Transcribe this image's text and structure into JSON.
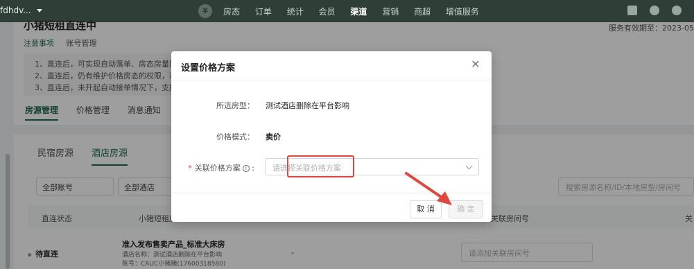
{
  "topbar": {
    "account": "fdhdv...",
    "logo": "¥",
    "nav": [
      "房态",
      "订单",
      "统计",
      "会员",
      "渠道",
      "营销",
      "商超",
      "增值服务"
    ],
    "nav_active_index": 4
  },
  "page": {
    "title": "小猪短租直连中",
    "expiry": "服务有效期至：2023-05",
    "notice_tab": "注意事项",
    "account_tab": "账号管理",
    "notices": [
      "1、直连后，可实现自动落单、房态房量同",
      "2、直连后，仍有维护价格房态的权限，若",
      "3、直连后，未开起自动接单情况下，支持"
    ],
    "main_tabs": [
      "房源管理",
      "价格管理",
      "消息通知"
    ],
    "sub_tabs": [
      "民宿房源",
      "酒店房源"
    ],
    "filters": [
      "全部账号",
      "全部酒店"
    ],
    "search_placeholder": "搜索房源名称/ID/本地房型/房间号",
    "table_headers": [
      "直连状态",
      "小猪短租房",
      "关联房间号",
      "关"
    ],
    "row": {
      "status": "待直连",
      "title": "准入发布售卖产品_标准大床房",
      "hotel": "酒店名称：测试酒店删除在平台影响",
      "account": "账号：CAUC小猪猪(17600318580)",
      "dash": "-",
      "room_placeholder": "请添加关联房间号"
    }
  },
  "modal": {
    "title": "设置价格方案",
    "room_type_label": "所选房型：",
    "room_type_value": "测试酒店删除在平台影响",
    "price_mode_label": "价格模式：",
    "price_mode_value": "卖价",
    "plan_label": "关联价格方案",
    "plan_placeholder": "请选择关联价格方案",
    "cancel": "取 消",
    "ok": "确 定"
  },
  "colors": {
    "brand": "#1d6b52",
    "topbar": "#2f3f38",
    "highlight": "#e0473f"
  }
}
